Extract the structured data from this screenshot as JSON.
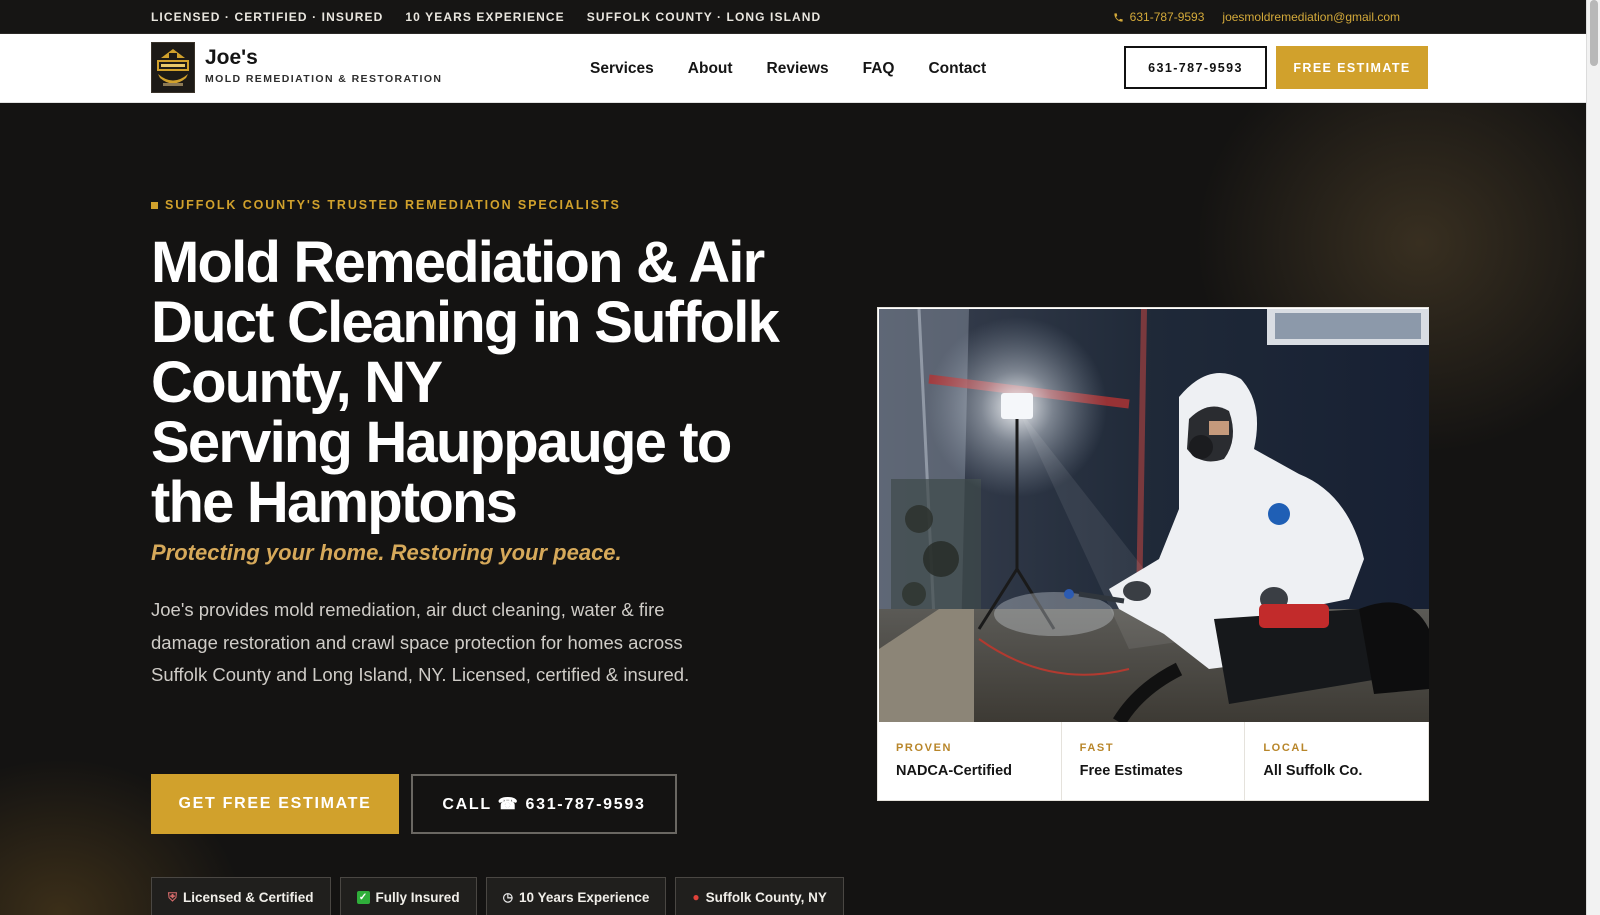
{
  "topbar": {
    "credentials": "LICENSED · CERTIFIED · INSURED",
    "experience": "10 YEARS EXPERIENCE",
    "area": "SUFFOLK COUNTY · LONG ISLAND",
    "phone": "631-787-9593",
    "email": "joesmoldremediation@gmail.com",
    "phone_icon": "phone-icon"
  },
  "header": {
    "logo_icon": "joes-logo",
    "brand_name": "Joe's",
    "brand_tagline": "MOLD REMEDIATION & RESTORATION",
    "nav": [
      "Services",
      "About",
      "Reviews",
      "FAQ",
      "Contact"
    ],
    "phone_button": "631-787-9593",
    "estimate_button": "FREE ESTIMATE"
  },
  "hero": {
    "eyebrow": "SUFFOLK COUNTY'S TRUSTED REMEDIATION SPECIALISTS",
    "title_line1": "Mold Remediation & Air",
    "title_line2": "Duct Cleaning in Suffolk",
    "title_line3": "County, NY",
    "title_line4": "Serving Hauppauge to",
    "title_line5": "the Hamptons",
    "tagline": "Protecting your home. Restoring your peace.",
    "description": "Joe's provides mold remediation, air duct cleaning, water & fire damage restoration and crawl space protection for homes across Suffolk County and Long Island, NY. Licensed, certified & insured.",
    "cta_primary": "GET FREE ESTIMATE",
    "cta_secondary": "CALL ☎ 631-787-9593",
    "badges": [
      {
        "icon": "shield-icon",
        "label": "Licensed & Certified"
      },
      {
        "icon": "check-icon",
        "label": "Fully Insured"
      },
      {
        "icon": "clock-icon",
        "label": "10 Years Experience"
      },
      {
        "icon": "pin-icon",
        "label": "Suffolk County, NY"
      }
    ]
  },
  "card": {
    "photo_icon": "technician-photo",
    "stats": [
      {
        "label": "PROVEN",
        "value": "NADCA-Certified"
      },
      {
        "label": "FAST",
        "value": "Free Estimates"
      },
      {
        "label": "LOCAL",
        "value": "All Suffolk Co."
      }
    ]
  },
  "colors": {
    "accent": "#d1a12c",
    "background": "#141312",
    "tagline": "#d6a95a"
  }
}
